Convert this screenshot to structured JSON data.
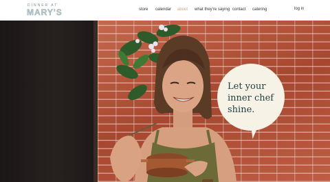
{
  "header": {
    "logo_top": "DINNER AT",
    "logo_bottom": "MARY'S",
    "nav": [
      {
        "label": "store",
        "active": false
      },
      {
        "label": "calendar",
        "active": false
      },
      {
        "label": "about",
        "active": true
      },
      {
        "label": "what they're saying",
        "active": false
      },
      {
        "label": "contact",
        "active": false
      },
      {
        "label": "catering",
        "active": false
      }
    ],
    "login_label": "log in",
    "active_color": "#c9a48c"
  },
  "hero": {
    "tagline_lines": [
      "Let your",
      "inner chef",
      "shine."
    ],
    "bubble_color": "#f6f3e6",
    "text_color": "#1f3b40"
  }
}
